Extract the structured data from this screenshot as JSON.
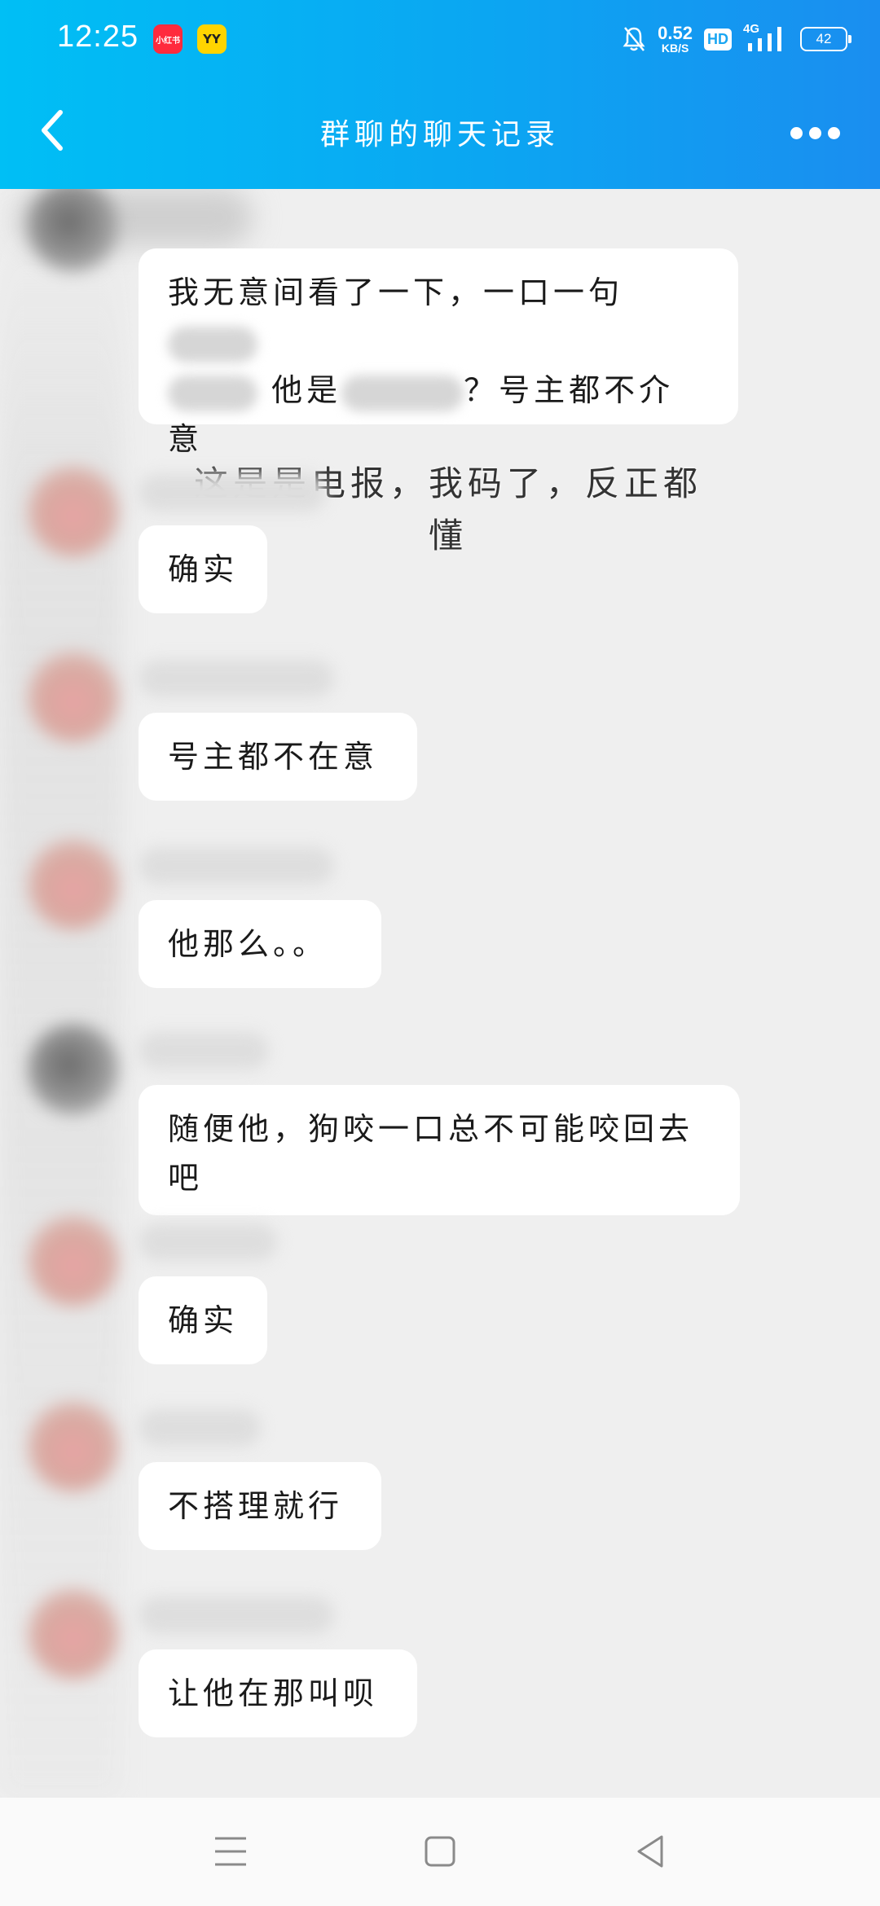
{
  "status_bar": {
    "time": "12:25",
    "app_badge_1": "小红书",
    "app_badge_2": "YY",
    "net_speed_value": "0.52",
    "net_speed_unit": "KB/S",
    "hd": "HD",
    "network": "4G",
    "battery": "42"
  },
  "header": {
    "title": "群聊的聊天记录"
  },
  "messages": [
    {
      "parts": [
        "我无意间看了一下，一口一句",
        "他是",
        "？号主都不介意"
      ]
    },
    {
      "text": "确实"
    },
    {
      "text": "号主都不在意"
    },
    {
      "text": "他那么。。"
    },
    {
      "text": "随便他，狗咬一口总不可能咬回去吧"
    },
    {
      "text": "确实"
    },
    {
      "text": "不搭理就行"
    },
    {
      "text": "让他在那叫呗"
    }
  ],
  "overlay_note": "这是是电报，我码了，反正都懂",
  "colors": {
    "header_start": "#00bff5",
    "header_end": "#1a8ef0",
    "background": "#efefef",
    "bubble": "#ffffff"
  },
  "icons": {
    "back": "chevron-left-icon",
    "more": "more-dots-icon",
    "nav_menu": "menu-lines-icon",
    "nav_home": "square-home-icon",
    "nav_back": "triangle-back-icon"
  }
}
